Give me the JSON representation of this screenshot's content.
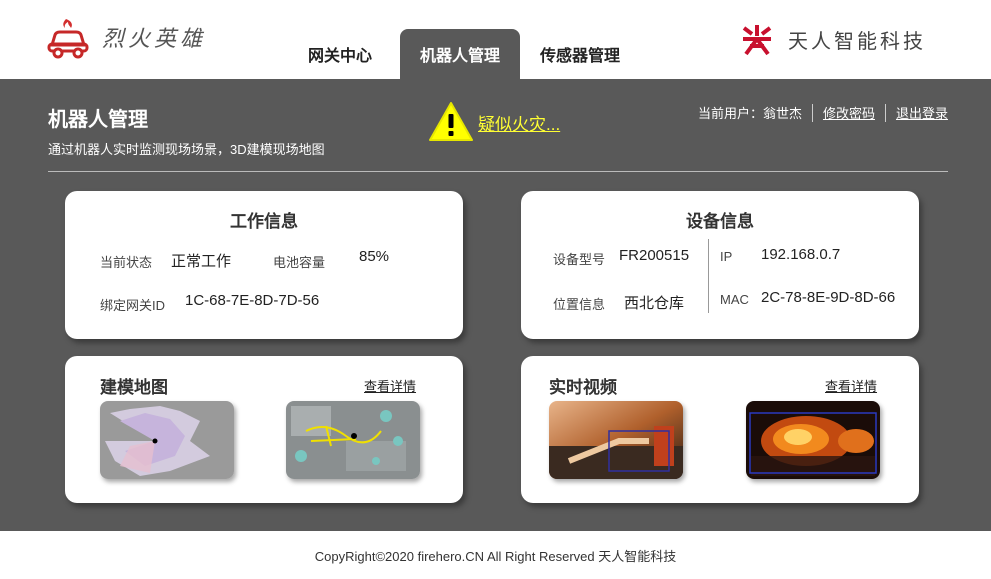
{
  "header": {
    "brand": "烈火英雄",
    "company": "天人智能科技",
    "tabs": [
      {
        "label": "网关中心"
      },
      {
        "label": "机器人管理"
      },
      {
        "label": "传感器管理"
      }
    ],
    "active_tab": "机器人管理"
  },
  "page": {
    "title": "机器人管理",
    "subtitle": "通过机器人实时监测现场场景，3D建模现场地图"
  },
  "alert": {
    "text": "疑似火灾..."
  },
  "user": {
    "current_user": "当前用户：翁世杰",
    "change_password": "修改密码",
    "logout": "退出登录"
  },
  "work_info": {
    "title": "工作信息",
    "status_label": "当前状态",
    "status_value": "正常工作",
    "battery_label": "电池容量",
    "battery_value": "85%",
    "gateway_label": "绑定网关ID",
    "gateway_value": "1C-68-7E-8D-7D-56"
  },
  "device_info": {
    "title": "设备信息",
    "model_label": "设备型号",
    "model_value": "FR200515",
    "location_label": "位置信息",
    "location_value": "西北仓库",
    "ip_label": "IP",
    "ip_value": "192.168.0.7",
    "mac_label": "MAC",
    "mac_value": "2C-78-8E-9D-8D-66"
  },
  "map_card": {
    "title": "建模地图",
    "more": "查看详情"
  },
  "video_card": {
    "title": "实时视频",
    "more": "查看详情"
  },
  "footer": {
    "text": "CopyRight©2020 firehero.CN All Right Reserved 天人智能科技"
  },
  "colors": {
    "main_bg": "#595959",
    "alert": "#ffff33",
    "brand_red": "#c8102e"
  }
}
